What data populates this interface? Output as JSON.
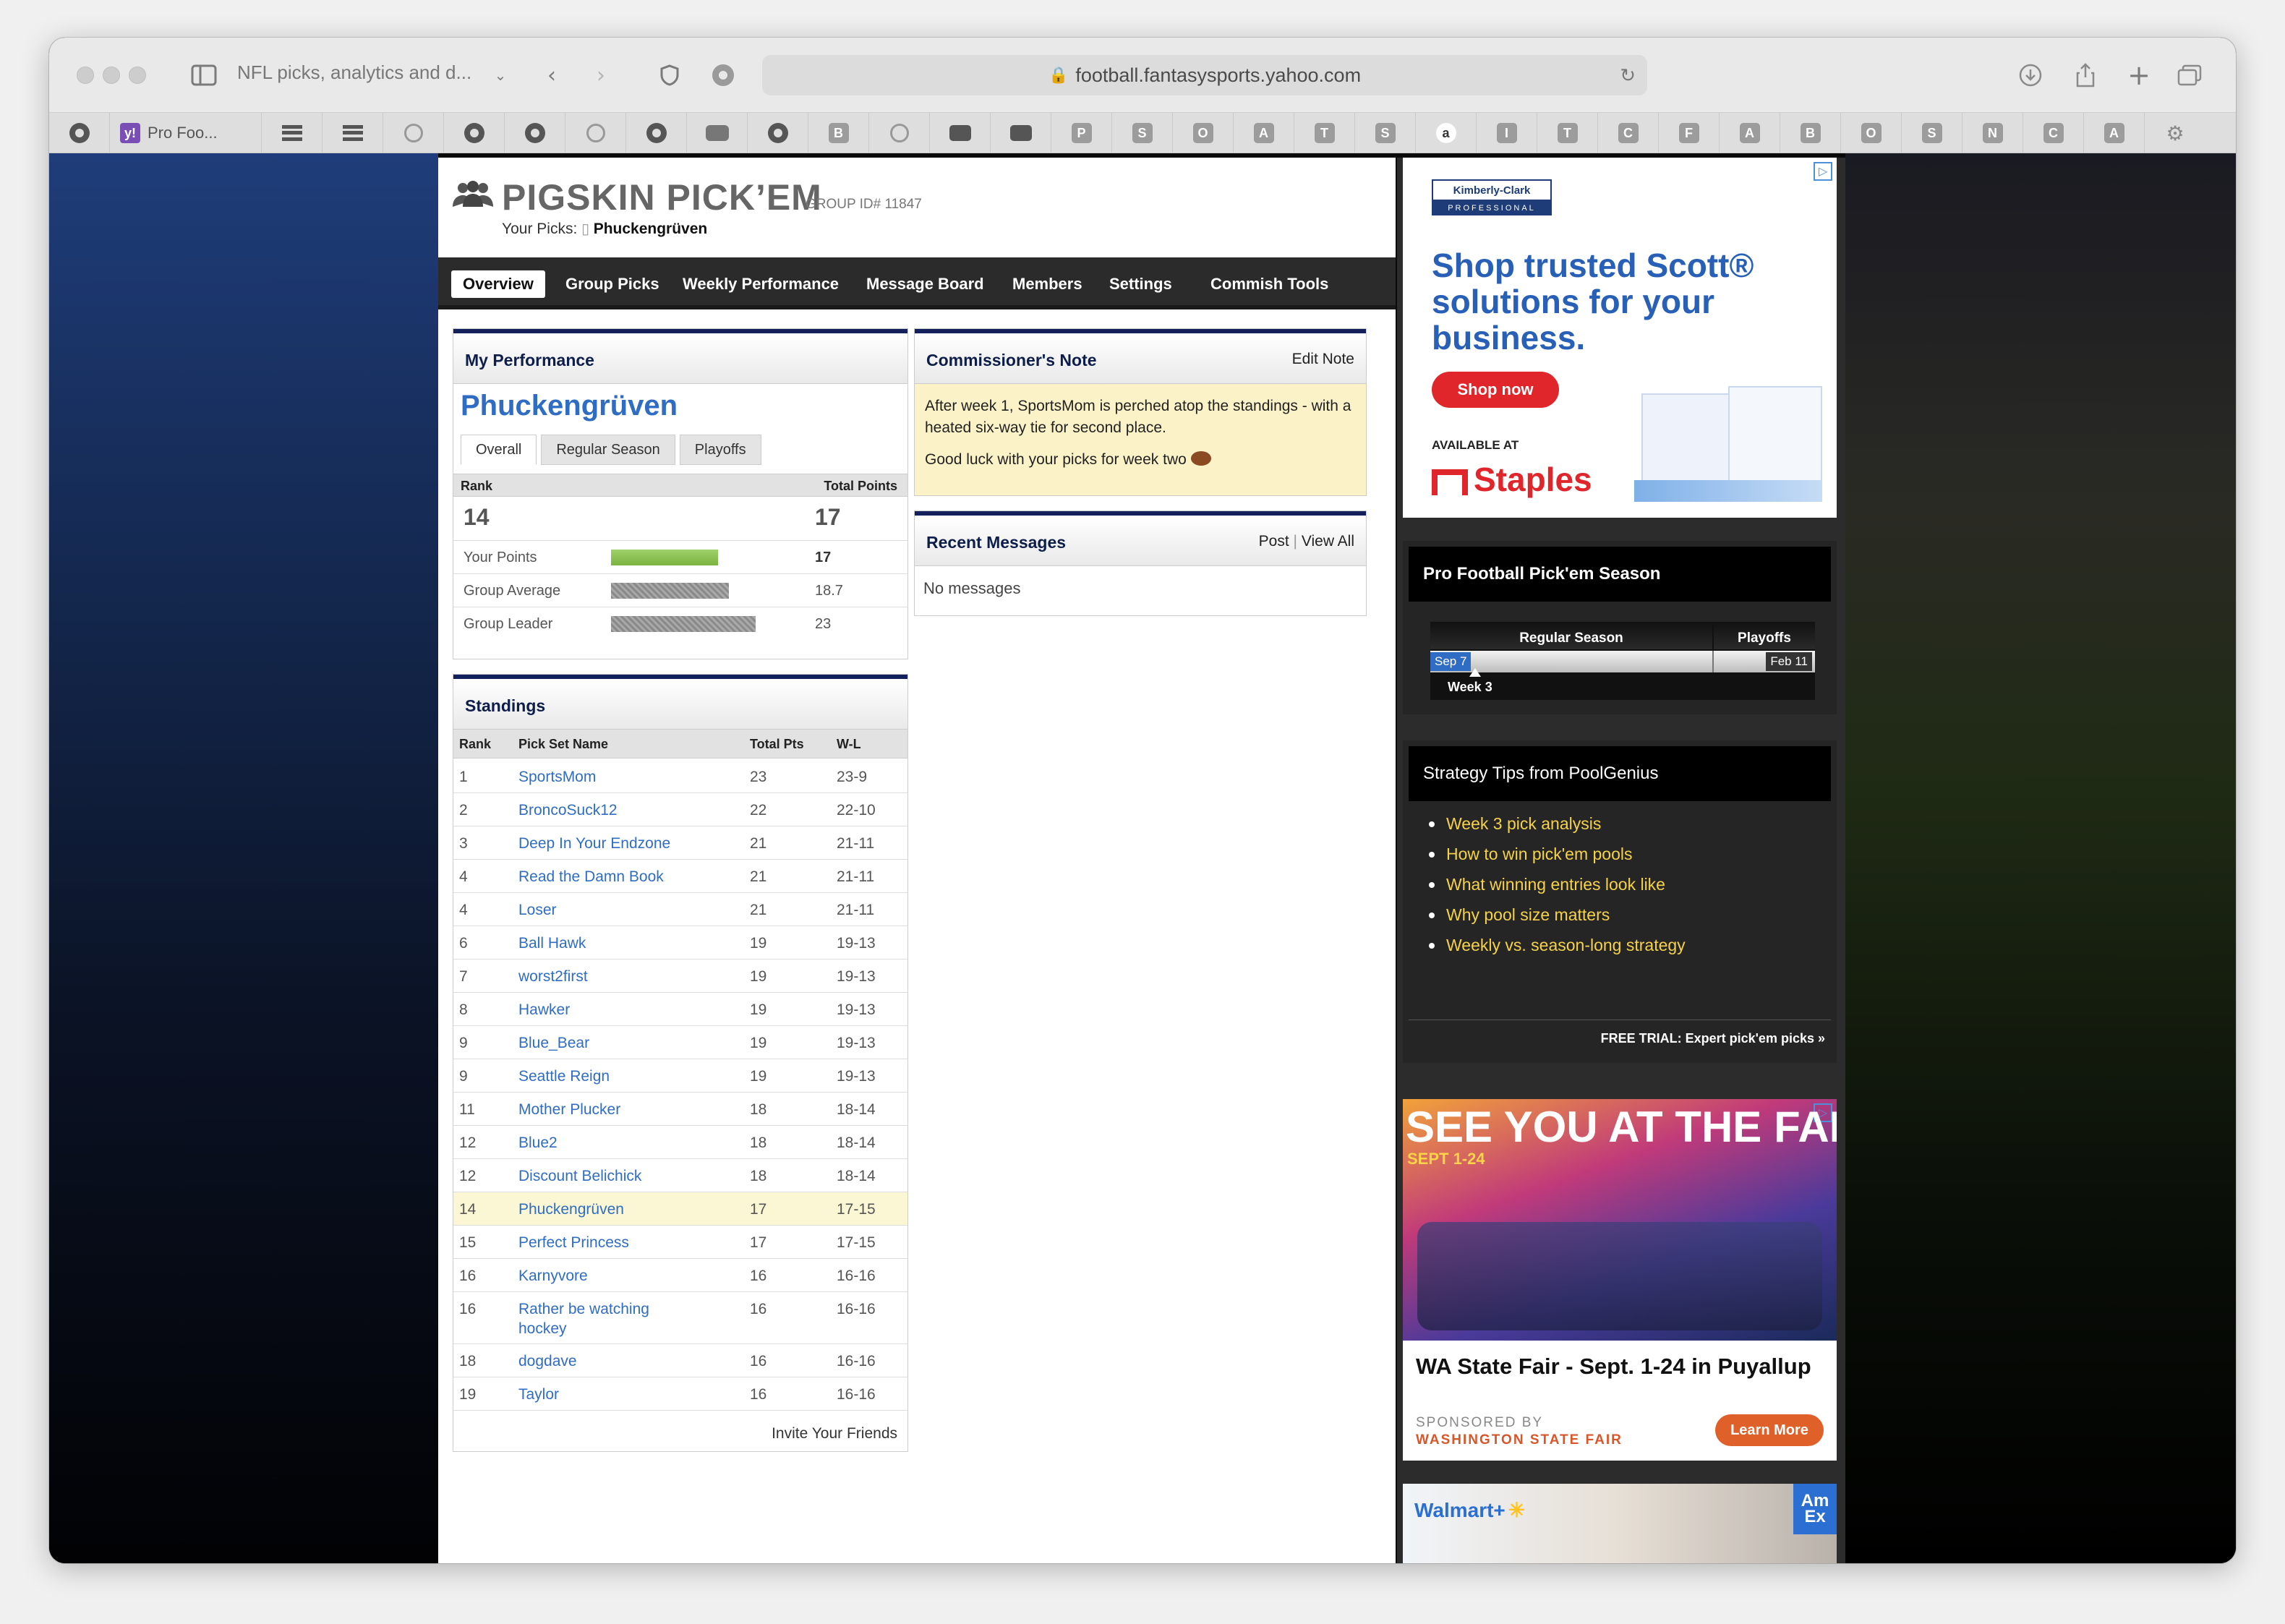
{
  "browser": {
    "tab_title": "NFL picks, analytics and d...",
    "url": "football.fantasysports.yahoo.com",
    "fav_tab_label": "Pro Foo...",
    "fav_letters": [
      "P",
      "S",
      "O",
      "A",
      "T",
      "S",
      "a",
      "I",
      "T",
      "C",
      "F",
      "A",
      "B",
      "O",
      "S",
      "N",
      "C",
      "A"
    ],
    "fav_letters_b": [
      "B"
    ]
  },
  "header": {
    "title": "PIGSKIN PICK’EM",
    "group_id": "GROUP ID# 11847",
    "your_picks_label": "Your Picks:",
    "your_picks_name": "Phuckengrüven"
  },
  "nav": {
    "items": [
      "Overview",
      "Group Picks",
      "Weekly Performance",
      "Message Board",
      "Members",
      "Settings",
      "Commish Tools"
    ]
  },
  "my_performance": {
    "title": "My Performance",
    "player": "Phuckengrüven",
    "tabs": [
      "Overall",
      "Regular Season",
      "Playoffs"
    ],
    "rank_label": "Rank",
    "total_label": "Total Points",
    "rank": "14",
    "total": "17",
    "rows": [
      {
        "label": "Your Points",
        "value": "17",
        "ratio": 0.739,
        "color": "#7cb342"
      },
      {
        "label": "Group Average",
        "value": "18.7",
        "ratio": 0.813,
        "color": "#9a9a9a"
      },
      {
        "label": "Group Leader",
        "value": "23",
        "ratio": 1.0,
        "color": "#9a9a9a"
      }
    ]
  },
  "commissioner": {
    "title": "Commissioner's Note",
    "edit": "Edit Note",
    "text1": "After week 1, SportsMom is perched atop the standings - with a heated six-way tie for second place.",
    "text2": "Good luck with your picks for week two"
  },
  "messages": {
    "title": "Recent Messages",
    "post": "Post",
    "view_all": "View All",
    "empty": "No messages"
  },
  "standings": {
    "title": "Standings",
    "headers": [
      "Rank",
      "Pick Set Name",
      "Total Pts",
      "W-L"
    ],
    "rows": [
      {
        "rank": "1",
        "name": "SportsMom",
        "pts": "23",
        "wl": "23-9"
      },
      {
        "rank": "2",
        "name": "BroncoSuck12",
        "pts": "22",
        "wl": "22-10"
      },
      {
        "rank": "3",
        "name": "Deep In Your Endzone",
        "pts": "21",
        "wl": "21-11"
      },
      {
        "rank": "4",
        "name": "Read the Damn Book",
        "pts": "21",
        "wl": "21-11"
      },
      {
        "rank": "4",
        "name": "Loser",
        "pts": "21",
        "wl": "21-11"
      },
      {
        "rank": "6",
        "name": "Ball Hawk",
        "pts": "19",
        "wl": "19-13"
      },
      {
        "rank": "7",
        "name": "worst2first",
        "pts": "19",
        "wl": "19-13"
      },
      {
        "rank": "8",
        "name": "Hawker",
        "pts": "19",
        "wl": "19-13"
      },
      {
        "rank": "9",
        "name": "Blue_Bear",
        "pts": "19",
        "wl": "19-13"
      },
      {
        "rank": "9",
        "name": "Seattle Reign",
        "pts": "19",
        "wl": "19-13"
      },
      {
        "rank": "11",
        "name": "Mother Plucker",
        "pts": "18",
        "wl": "18-14"
      },
      {
        "rank": "12",
        "name": "Blue2",
        "pts": "18",
        "wl": "18-14"
      },
      {
        "rank": "12",
        "name": "Discount Belichick",
        "pts": "18",
        "wl": "18-14"
      },
      {
        "rank": "14",
        "name": "Phuckengrüven",
        "pts": "17",
        "wl": "17-15",
        "highlight": true
      },
      {
        "rank": "15",
        "name": "Perfect Princess",
        "pts": "17",
        "wl": "17-15"
      },
      {
        "rank": "16",
        "name": "Karnyvore",
        "pts": "16",
        "wl": "16-16"
      },
      {
        "rank": "16",
        "name": "Rather be watching hockey",
        "pts": "16",
        "wl": "16-16",
        "tall": true
      },
      {
        "rank": "18",
        "name": "dogdave",
        "pts": "16",
        "wl": "16-16"
      },
      {
        "rank": "19",
        "name": "Taylor",
        "pts": "16",
        "wl": "16-16"
      }
    ],
    "invite": "Invite Your Friends"
  },
  "ad_scott": {
    "brand": "Kimberly-Clark",
    "brand_sub": "PROFESSIONAL",
    "headline": "Shop trusted Scott® solutions for your business.",
    "cta": "Shop now",
    "available": "AVAILABLE AT",
    "retailer": "Staples"
  },
  "season": {
    "title": "Pro Football Pick'em Season",
    "regular": "Regular Season",
    "playoffs": "Playoffs",
    "start": "Sep 7",
    "end": "Feb 11",
    "week": "Week 3"
  },
  "tips": {
    "title": "Strategy Tips from PoolGenius",
    "items": [
      "Week 3 pick analysis",
      "How to win pick'em pools",
      "What winning entries look like",
      "Why pool size matters",
      "Weekly vs. season-long strategy"
    ],
    "trial": "FREE TRIAL: Expert pick'em picks »"
  },
  "ad_fair": {
    "banner": "SEE YOU AT THE FAIR!",
    "dates": "SEPT 1-24",
    "headline": "WA State Fair - Sept. 1-24 in Puyallup",
    "sponsored": "SPONSORED BY",
    "sponsor": "WASHINGTON STATE FAIR",
    "cta": "Learn More"
  },
  "ad_walmart": {
    "brand": "Walmart+",
    "corner": "Am Ex"
  }
}
